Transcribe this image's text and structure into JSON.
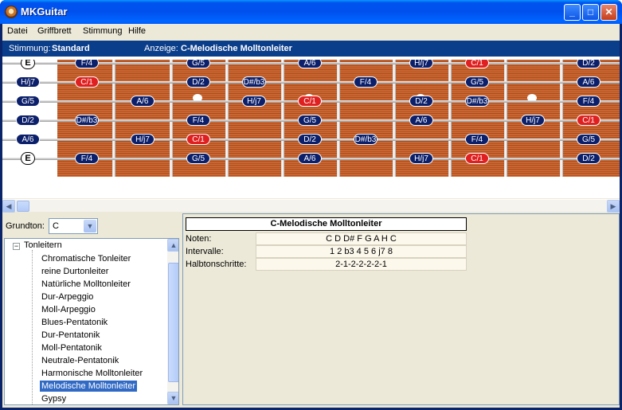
{
  "window": {
    "title": "MKGuitar"
  },
  "menu": [
    "Datei",
    "Griffbrett",
    "Stimmung",
    "Hilfe"
  ],
  "status": {
    "stimmung_label": "Stimmung:",
    "stimmung_value": "Standard",
    "anzeige_label": "Anzeige:",
    "anzeige_value": "C-Melodische Molltonleiter"
  },
  "fretboard": {
    "open_strings": [
      "E",
      "H/j7",
      "G/5",
      "D/2",
      "A/6",
      "E"
    ],
    "strings": [
      [
        null,
        "F/4",
        null,
        "G/5",
        null,
        "A/6",
        null,
        "H/j7",
        "C/1",
        null,
        "D/2"
      ],
      [
        "H/j7",
        "C/1",
        null,
        "D/2",
        "D#/b3",
        null,
        "F/4",
        null,
        "G/5",
        null,
        "A/6"
      ],
      [
        "G/5",
        null,
        "A/6",
        null,
        "H/j7",
        "C/1",
        null,
        "D/2",
        "D#/b3",
        null,
        "F/4"
      ],
      [
        "D/2",
        "D#/b3",
        null,
        "F/4",
        null,
        "G/5",
        null,
        "A/6",
        null,
        "H/j7",
        "C/1"
      ],
      [
        "A/6",
        null,
        "H/j7",
        "C/1",
        null,
        "D/2",
        "D#/b3",
        null,
        "F/4",
        null,
        "G/5"
      ],
      [
        null,
        "F/4",
        null,
        "G/5",
        null,
        "A/6",
        null,
        "H/j7",
        "C/1",
        null,
        "D/2"
      ]
    ],
    "root_note": "C/1"
  },
  "grundton": {
    "label": "Grundton:",
    "value": "C"
  },
  "tree": {
    "root": "Tonleitern",
    "items": [
      "Chromatische Tonleiter",
      "reine Durtonleiter",
      "Natürliche Molltonleiter",
      "Dur-Arpeggio",
      "Moll-Arpeggio",
      "Blues-Pentatonik",
      "Dur-Pentatonik",
      "Moll-Pentatonik",
      "Neutrale-Pentatonik",
      "Harmonische Molltonleiter",
      "Melodische Molltonleiter",
      "Gypsy"
    ],
    "selected": "Melodische Molltonleiter"
  },
  "info": {
    "title": "C-Melodische Molltonleiter",
    "rows": [
      {
        "label": "Noten:",
        "value": "C D D# F G A H C"
      },
      {
        "label": "Intervalle:",
        "value": "1 2 b3 4 5 6 j7 8"
      },
      {
        "label": "Halbtonschritte:",
        "value": "2-1-2-2-2-2-1"
      }
    ]
  }
}
